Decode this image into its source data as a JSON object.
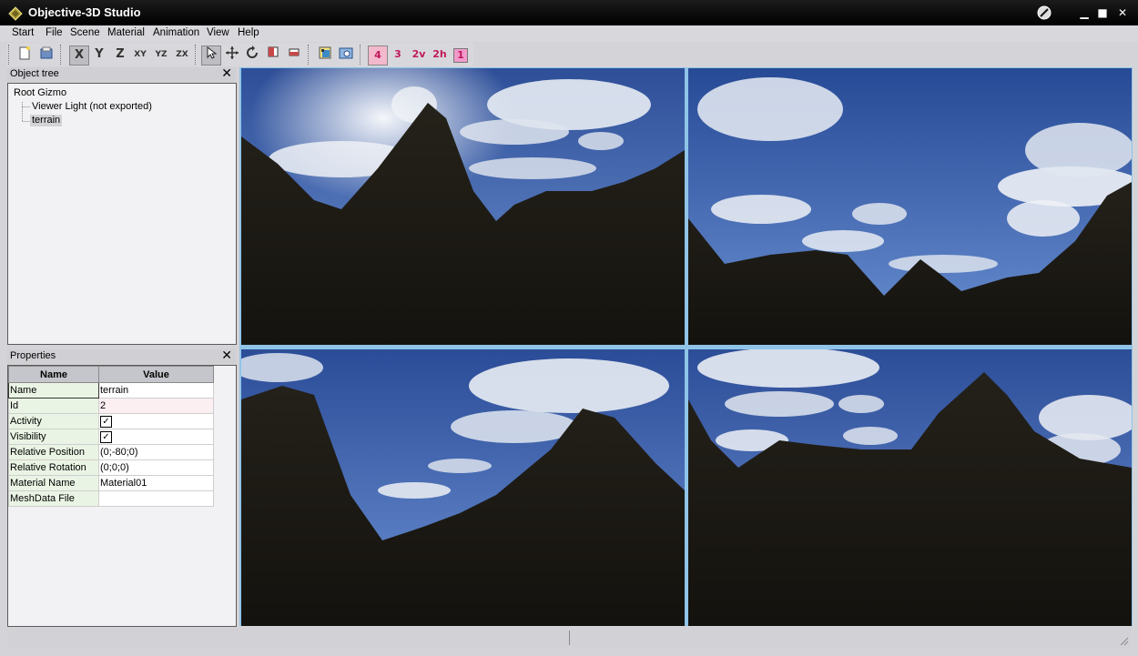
{
  "window": {
    "title": "Objective-3D Studio"
  },
  "menu": [
    {
      "label": "Start"
    },
    {
      "label": "File"
    },
    {
      "label": "Scene"
    },
    {
      "label": "Material"
    },
    {
      "label": "Animation"
    },
    {
      "label": "View"
    },
    {
      "label": "Help"
    }
  ],
  "toolbar": {
    "axis_x": "X",
    "axis_y": "Y",
    "axis_z": "Z",
    "plane_xy": "XY",
    "plane_yz": "YZ",
    "plane_zx": "ZX",
    "layout_4": "4",
    "layout_3": "3",
    "layout_2v": "2v",
    "layout_2h": "2h",
    "layout_1": "1"
  },
  "object_tree": {
    "title": "Object tree",
    "close": "✕",
    "items": [
      {
        "label": "Root Gizmo"
      },
      {
        "label": "Viewer Light (not exported)"
      },
      {
        "label": "terrain"
      }
    ]
  },
  "properties": {
    "title": "Properties",
    "close": "✕",
    "col_name": "Name",
    "col_value": "Value",
    "rows": [
      {
        "name": "Name",
        "value": "terrain"
      },
      {
        "name": "Id",
        "value": "2"
      },
      {
        "name": "Activity",
        "value": "✓"
      },
      {
        "name": "Visibility",
        "value": "✓"
      },
      {
        "name": "Relative Position",
        "value": "(0;-80;0)"
      },
      {
        "name": "Relative Rotation",
        "value": "(0;0;0)"
      },
      {
        "name": "Material Name",
        "value": "Material01"
      },
      {
        "name": "MeshData File",
        "value": ""
      }
    ]
  },
  "colors": {
    "sky_top": "#2d4f9a",
    "sky_bottom": "#6b8fd0",
    "terrain": "#1a1812",
    "viewport_border": "#8fc4e8"
  }
}
